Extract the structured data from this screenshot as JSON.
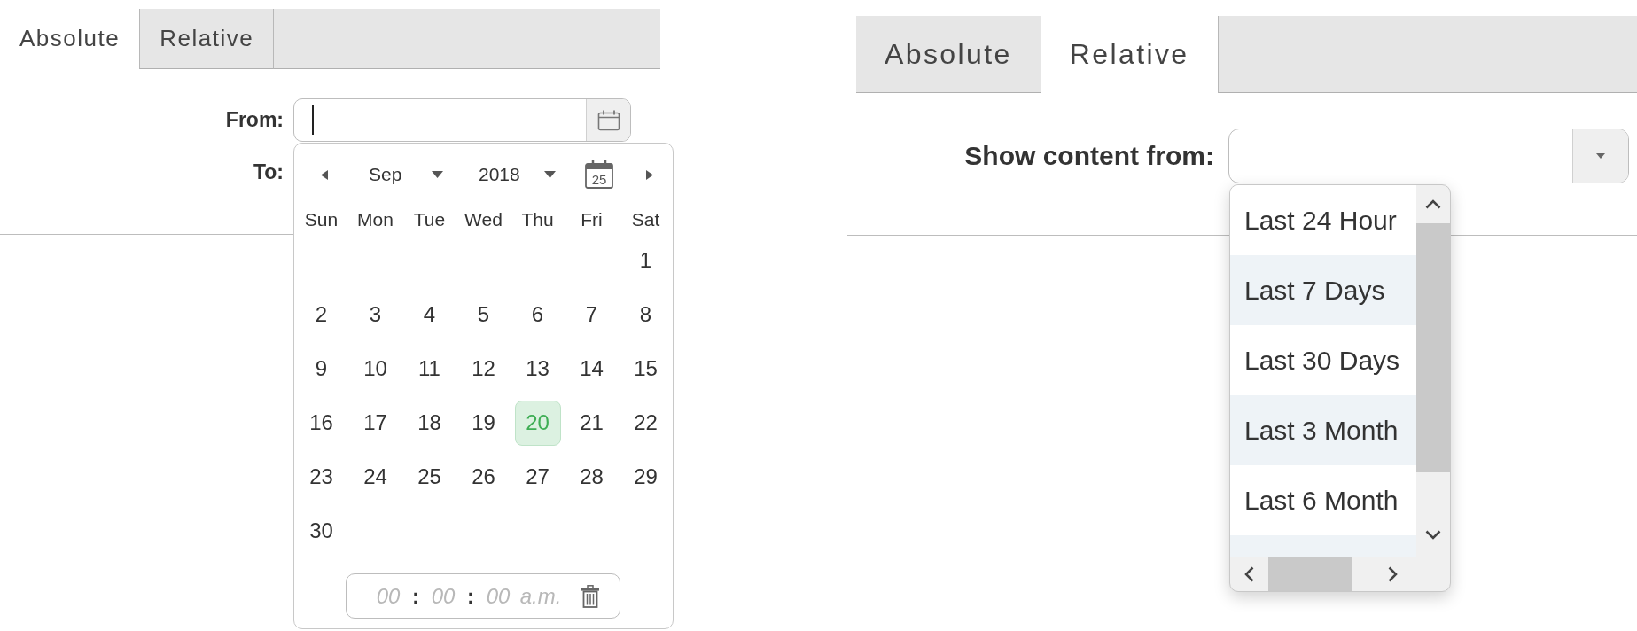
{
  "absolute_panel": {
    "tabs": [
      {
        "label": "Absolute",
        "selected": true
      },
      {
        "label": "Relative",
        "selected": false
      }
    ],
    "from": {
      "label": "From:",
      "focused": true
    },
    "to": {
      "label": "To:"
    },
    "date_picker": {
      "month": "Sep",
      "year": "2018",
      "today_icon_text": "25",
      "weekdays": [
        "Sun",
        "Mon",
        "Tue",
        "Wed",
        "Thu",
        "Fri",
        "Sat"
      ],
      "weeks": [
        {
          "days": [
            {
              "label": "1",
              "selected": false
            }
          ]
        },
        {
          "days": [
            {
              "label": "2",
              "selected": false
            },
            {
              "label": "3",
              "selected": false
            },
            {
              "label": "4",
              "selected": false
            },
            {
              "label": "5",
              "selected": false
            },
            {
              "label": "6",
              "selected": false
            },
            {
              "label": "7",
              "selected": false
            },
            {
              "label": "8",
              "selected": false
            }
          ]
        },
        {
          "days": [
            {
              "label": "9",
              "selected": false
            },
            {
              "label": "10",
              "selected": false
            },
            {
              "label": "11",
              "selected": false
            },
            {
              "label": "12",
              "selected": false
            },
            {
              "label": "13",
              "selected": false
            },
            {
              "label": "14",
              "selected": false
            },
            {
              "label": "15",
              "selected": false
            }
          ]
        },
        {
          "days": [
            {
              "label": "16",
              "selected": false
            },
            {
              "label": "17",
              "selected": false
            },
            {
              "label": "18",
              "selected": false
            },
            {
              "label": "19",
              "selected": false
            },
            {
              "label": "20",
              "selected": true
            },
            {
              "label": "21",
              "selected": false
            },
            {
              "label": "22",
              "selected": false
            }
          ]
        },
        {
          "days": [
            {
              "label": "23",
              "selected": false
            },
            {
              "label": "24",
              "selected": false
            },
            {
              "label": "25",
              "selected": false
            },
            {
              "label": "26",
              "selected": false
            },
            {
              "label": "27",
              "selected": false
            },
            {
              "label": "28",
              "selected": false
            },
            {
              "label": "29",
              "selected": false
            }
          ]
        },
        {
          "days": [
            {
              "label": "30",
              "selected": false
            }
          ]
        }
      ],
      "time": {
        "parts": [
          {
            "kind": "field",
            "placeholder": "00"
          },
          {
            "kind": "separator",
            "text": ":"
          },
          {
            "kind": "field",
            "placeholder": "00"
          },
          {
            "kind": "separator",
            "text": ":"
          },
          {
            "kind": "field",
            "placeholder": "00"
          },
          {
            "kind": "period",
            "placeholder": "a.m."
          }
        ]
      }
    }
  },
  "relative_panel": {
    "tabs": [
      {
        "label": "Absolute",
        "selected": false
      },
      {
        "label": "Relative",
        "selected": true
      }
    ],
    "show_content_from": {
      "label": "Show content from:"
    },
    "options": [
      {
        "label": "Last 24 Hour"
      },
      {
        "label": "Last 7 Days"
      },
      {
        "label": "Last 30 Days"
      },
      {
        "label": "Last 3 Month"
      },
      {
        "label": "Last 6 Month"
      }
    ]
  }
}
